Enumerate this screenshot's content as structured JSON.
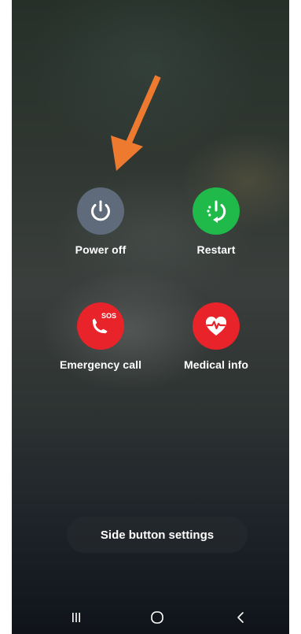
{
  "actions": {
    "power_off": {
      "label": "Power off",
      "color": "#5f6b7a",
      "icon": "power-icon"
    },
    "restart": {
      "label": "Restart",
      "color": "#1fba4a",
      "icon": "restart-icon"
    },
    "emergency_call": {
      "label": "Emergency call",
      "color": "#e8232a",
      "icon": "sos-phone-icon",
      "badge": "SOS"
    },
    "medical_info": {
      "label": "Medical info",
      "color": "#e8232a",
      "icon": "heart-pulse-icon"
    }
  },
  "side_button": {
    "label": "Side button settings"
  },
  "annotation": {
    "arrow_color": "#ee7a2f",
    "icon": "arrow-pointer-icon"
  },
  "navbar": {
    "recents": {
      "icon": "recents-icon"
    },
    "home": {
      "icon": "home-icon"
    },
    "back": {
      "icon": "back-icon"
    }
  }
}
